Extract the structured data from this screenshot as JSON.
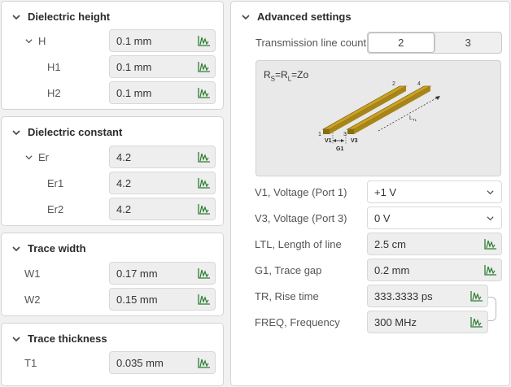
{
  "dielectric_height": {
    "title": "Dielectric height",
    "rows": [
      {
        "label": "H",
        "value": "0.1 mm"
      },
      {
        "label": "H1",
        "value": "0.1 mm"
      },
      {
        "label": "H2",
        "value": "0.1 mm"
      }
    ]
  },
  "dielectric_constant": {
    "title": "Dielectric constant",
    "rows": [
      {
        "label": "Er",
        "value": "4.2"
      },
      {
        "label": "Er1",
        "value": "4.2"
      },
      {
        "label": "Er2",
        "value": "4.2"
      }
    ]
  },
  "trace_width": {
    "title": "Trace width",
    "rows": [
      {
        "label": "W1",
        "value": "0.17 mm"
      },
      {
        "label": "W2",
        "value": "0.15 mm"
      }
    ]
  },
  "trace_thickness": {
    "title": "Trace thickness",
    "rows": [
      {
        "label": "T1",
        "value": "0.035 mm"
      }
    ]
  },
  "advanced": {
    "title": "Advanced settings",
    "tl_count_label": "Transmission line count",
    "tl_count_options": [
      "2",
      "3"
    ],
    "tl_count_selected": "2",
    "diagram": {
      "formula_rs": "R",
      "formula_rs_sub": "S",
      "formula_eq1": "=R",
      "formula_rl_sub": "L",
      "formula_eq2": "=Zo",
      "labels": {
        "n1": "1",
        "n2": "2",
        "n3": "3",
        "n4": "4",
        "v1": "V1",
        "v3": "V3",
        "g1": "G1",
        "ltl": "L",
        "ltl_sub": "TL"
      }
    },
    "rows": [
      {
        "label": "V1, Voltage (Port 1)",
        "value": "+1 V",
        "kind": "dropdown"
      },
      {
        "label": "V3, Voltage (Port 3)",
        "value": "0 V",
        "kind": "dropdown"
      },
      {
        "label": "LTL, Length of line",
        "value": "2.5 cm",
        "kind": "input"
      },
      {
        "label": "G1, Trace gap",
        "value": "0.2 mm",
        "kind": "input"
      },
      {
        "label": "TR, Rise time",
        "value": "333.3333 ps",
        "kind": "input"
      },
      {
        "label": "FREQ, Frequency",
        "value": "300 MHz",
        "kind": "input"
      }
    ]
  },
  "colors": {
    "icon_green": "#2e7d32",
    "trace_gold": "#b8860b",
    "panel_border": "#d4d4d4"
  },
  "icons": {
    "section_chevron": "chevron-down-icon",
    "row_chevron": "chevron-down-icon",
    "field_icon": "waveform-icon",
    "dropdown_icon": "chevron-down-icon"
  }
}
